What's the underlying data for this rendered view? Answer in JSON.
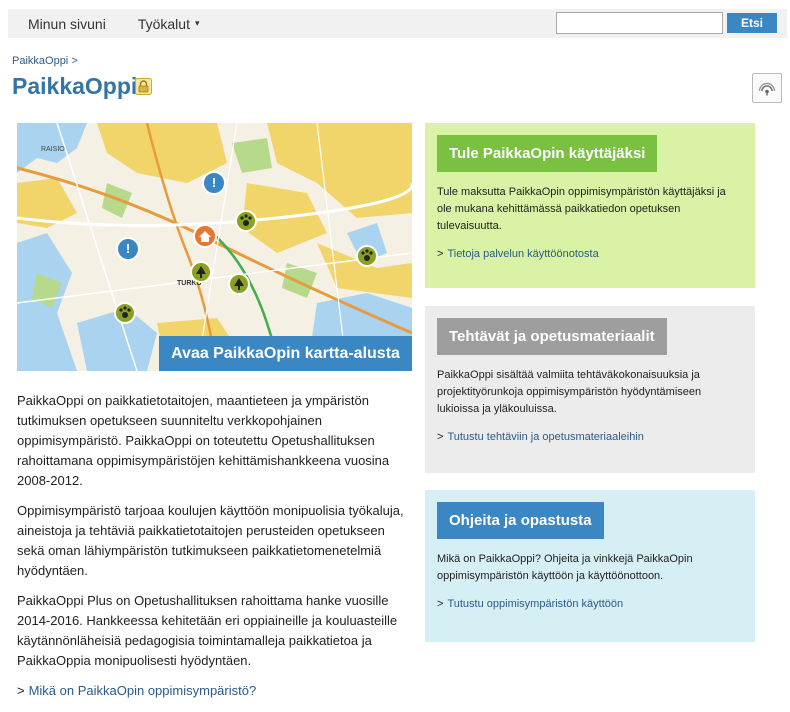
{
  "topnav": {
    "items": [
      {
        "label": "Minun sivuni"
      },
      {
        "label": "Työkalut",
        "caret": "▾"
      }
    ]
  },
  "search": {
    "value": "",
    "button_label": "Etsi"
  },
  "breadcrumb": {
    "items": [
      {
        "label": "PaikkaOppi"
      }
    ],
    "separator": ">"
  },
  "page": {
    "title": "PaikkaOppi",
    "icon": "lock-icon"
  },
  "rss": {
    "icon": "rss-icon"
  },
  "map": {
    "cta_label": "Avaa PaikkaOpin kartta-alusta",
    "labels": [
      "RAISIO",
      "TURKU"
    ]
  },
  "content": {
    "paragraphs": [
      "PaikkaOppi on paikkatietotaitojen, maantieteen ja ympäristön tutkimuksen opetukseen suunniteltu verkkopohjainen oppimisympäristö. PaikkaOppi on toteutettu Opetushallituksen rahoittamana oppimisympäristöjen kehittämishankkeena vuosina 2008-2012.",
      "Oppimisympäristö tarjoaa koulujen käyttöön monipuolisia työkaluja, aineistoja ja tehtäviä paikkatietotaitojen perusteiden opetukseen sekä oman lähiympäristön tutkimukseen paikkatietomenetelmiä hyödyntäen.",
      "PaikkaOppi Plus on Opetushallituksen rahoittama hanke vuosille 2014-2016. Hankkeessa kehitetään eri oppiaineille ja kouluasteille käytännönläheisiä pedagogisia toimintamalleja paikkatietoa ja PaikkaOppia monipuolisesti hyödyntäen."
    ],
    "more_link": "Mikä on PaikkaOpin oppimisympäristö?"
  },
  "panels": [
    {
      "title": "Tule PaikkaOpin käyttäjäksi",
      "text": "Tule maksutta PaikkaOpin oppimisympäristön käyttäjäksi ja ole mukana kehittämässä paikkatiedon opetuksen tulevaisuutta.",
      "link": "Tietoja palvelun käyttöönotosta",
      "color": "#d9f2a6"
    },
    {
      "title": "Tehtävät ja opetusmateriaalit",
      "text": "PaikkaOppi sisältää valmiita tehtäväkokonaisuuksia ja projektityörunkoja oppimisympäristön  hyödyntämiseen lukioissa ja yläkouluissa.",
      "link": "Tutustu tehtäviin ja opetusmateriaaleihin",
      "color": "#ececec"
    },
    {
      "title": "Ohjeita ja opastusta",
      "text": "Mikä on PaikkaOppi? Ohjeita ja vinkkejä PaikkaOpin oppimisympäristön käyttöön ja käyttöönottoon.",
      "link": "Tutustu oppimisympäristön käyttöön",
      "color": "#d6eff5"
    }
  ],
  "link_arrow": ">",
  "colors": {
    "accent": "#3b87c4",
    "title": "#3475a8",
    "link": "#2a5b8a",
    "green_header": "#7ac142",
    "gray_header": "#9e9e9e"
  }
}
